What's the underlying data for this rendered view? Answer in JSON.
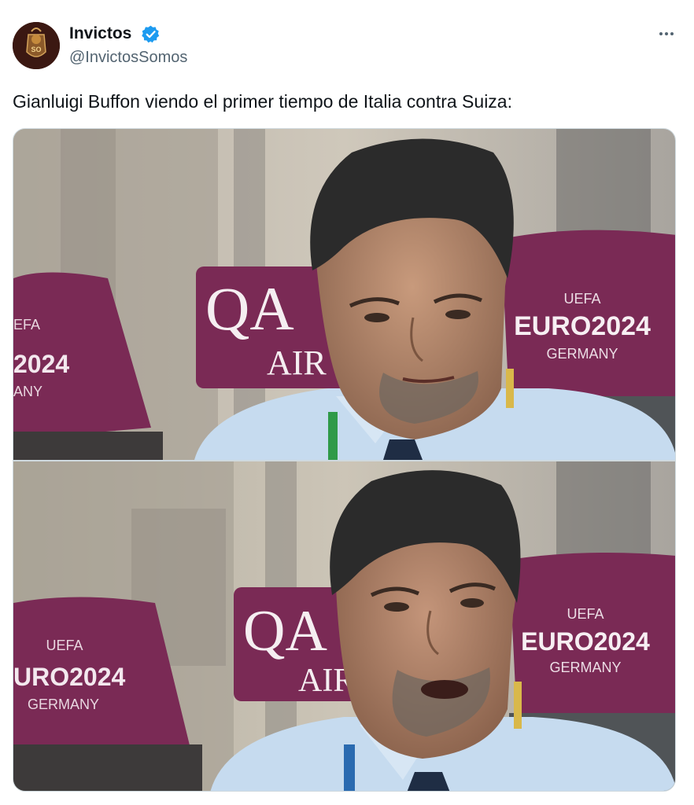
{
  "author": {
    "name": "Invictos",
    "handle": "@InvictosSomos",
    "verified_icon": "verified-badge-icon",
    "avatar_icon": "invictos-crest-logo",
    "avatar_text": "SO"
  },
  "tweet": {
    "text": "Gianluigi Buffon viendo el primer tiempo de Italia contra Suiza:",
    "more_icon": "more-options-icon"
  },
  "media": {
    "photo_1": {
      "sponsor_top": "QA",
      "sponsor_bottom": "AIR",
      "seat_logo": "UEFA",
      "seat_title": "EURO2024",
      "seat_subtitle": "GERMANY",
      "left_seat_title": "2024",
      "left_seat_logo": "EFA",
      "left_seat_subtitle": "ANY"
    },
    "photo_2": {
      "sponsor_top": "QA",
      "sponsor_bottom": "AIR",
      "seat_logo": "UEFA",
      "seat_title": "EURO2024",
      "seat_subtitle": "GERMANY",
      "left_seat_logo": "UEFA",
      "left_seat_title": "URO2024",
      "left_seat_subtitle": "GERMANY"
    }
  },
  "colors": {
    "accent_blue": "#1d9bf0",
    "seat_purple": "#7a2a55",
    "shirt_blue": "#c6dbef",
    "hair": "#2b2b2b"
  }
}
